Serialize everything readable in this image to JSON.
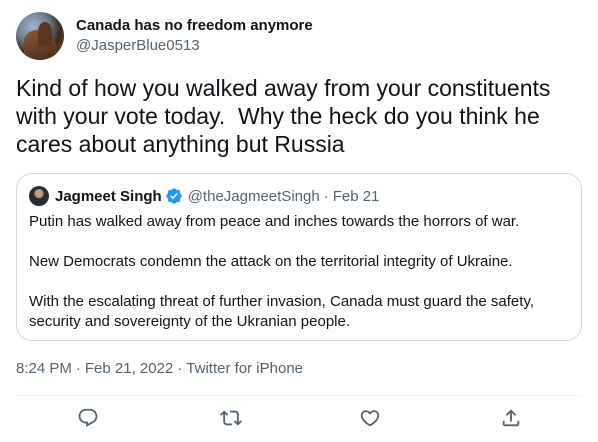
{
  "author": {
    "display_name": "Canada has no freedom anymore",
    "handle": "@JasperBlue0513"
  },
  "tweet": {
    "text": "Kind of how you walked away from your constituents with your vote today.  Why the heck do you think he cares about anything but Russia"
  },
  "quoted": {
    "display_name": "Jagmeet Singh",
    "handle": "@theJagmeetSingh",
    "separator": "·",
    "date": "Feb 21",
    "paragraphs": [
      "Putin has walked away from peace and inches towards the horrors of war.",
      "New Democrats condemn the attack on the territorial integrity of Ukraine.",
      "With the escalating threat of further invasion, Canada must guard the safety, security and sovereignty of the Ukranian people."
    ]
  },
  "meta": {
    "time": "8:24 PM",
    "separator": "·",
    "date": "Feb 21, 2022",
    "source": "Twitter for iPhone"
  },
  "actions": {
    "reply_icon": "reply-icon",
    "retweet_icon": "retweet-icon",
    "like_icon": "like-icon",
    "share_icon": "share-icon"
  },
  "colors": {
    "text": "#0f1419",
    "secondary": "#536471",
    "border": "#cfd9de",
    "verified": "#1d9bf0"
  }
}
